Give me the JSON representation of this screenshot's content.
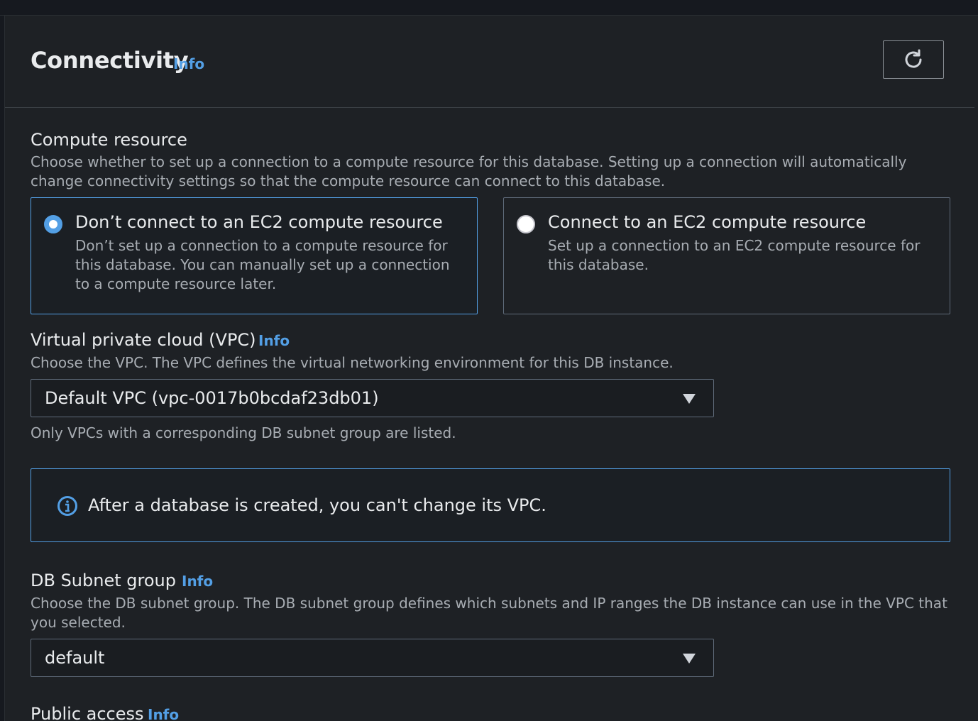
{
  "header": {
    "title": "Connectivity",
    "info": "Info",
    "refresh_icon": "refresh-icon"
  },
  "compute": {
    "label": "Compute resource",
    "description": "Choose whether to set up a connection to a compute resource for this database. Setting up a connection will automatically change connectivity settings so that the compute resource can connect to this database.",
    "options": [
      {
        "title": "Don’t connect to an EC2 compute resource",
        "description": "Don’t set up a connection to a compute resource for this database. You can manually set up a connection to a compute resource later.",
        "selected": true
      },
      {
        "title": "Connect to an EC2 compute resource",
        "description": "Set up a connection to an EC2 compute resource for this database.",
        "selected": false
      }
    ]
  },
  "vpc": {
    "label": "Virtual private cloud (VPC)",
    "info": "Info",
    "description": "Choose the VPC. The VPC defines the virtual networking environment for this DB instance.",
    "value": "Default VPC (vpc-0017b0bcdaf23db01)",
    "hint": "Only VPCs with a corresponding DB subnet group are listed."
  },
  "alert": {
    "icon": "info-circle-icon",
    "text": "After a database is created, you can't change its VPC."
  },
  "subnet": {
    "label": "DB Subnet group",
    "info": "Info",
    "description": "Choose the DB subnet group. The DB subnet group defines which subnets and IP ranges the DB instance can use in the VPC that you selected.",
    "value": "default"
  },
  "public_access": {
    "label": "Public access",
    "info": "Info"
  },
  "colors": {
    "accent": "#539fe5",
    "background": "#1e2125"
  }
}
